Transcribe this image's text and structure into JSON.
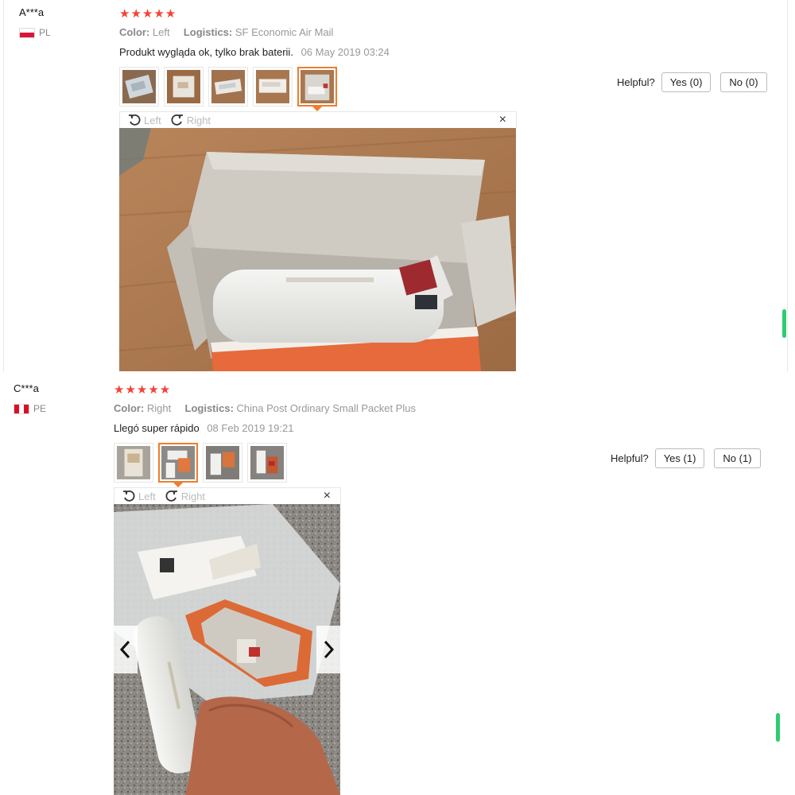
{
  "reviews": [
    {
      "buyer": "A***a",
      "country": "PL",
      "stars": "★★★★★",
      "color_label": "Color:",
      "color_value": "Left",
      "logistics_label": "Logistics:",
      "logistics_value": "SF Economic Air Mail",
      "text": "Produkt wygląda ok, tylko brak baterii.",
      "date": "06 May 2019 03:24",
      "helpful_label": "Helpful?",
      "yes_label": "Yes (0)",
      "no_label": "No (0)",
      "rotate_left": "Left",
      "rotate_right": "Right",
      "close": "×"
    },
    {
      "buyer": "C***a",
      "country": "PE",
      "stars": "★★★★★",
      "color_label": "Color:",
      "color_value": "Right",
      "logistics_label": "Logistics:",
      "logistics_value": "China Post Ordinary Small Packet Plus",
      "text": "Llegó super rápido",
      "date": "08 Feb 2019 19:21",
      "helpful_label": "Helpful?",
      "yes_label": "Yes (1)",
      "no_label": "No (1)",
      "rotate_left": "Left",
      "rotate_right": "Right",
      "close": "×"
    }
  ],
  "colors": {
    "star": "#f44336",
    "active_thumb": "#f07d2b",
    "scroll_marker": "#2ecc71"
  },
  "icons": [
    "rotate-left-icon",
    "rotate-right-icon",
    "close-icon",
    "chevron-left-icon",
    "chevron-right-icon"
  ]
}
